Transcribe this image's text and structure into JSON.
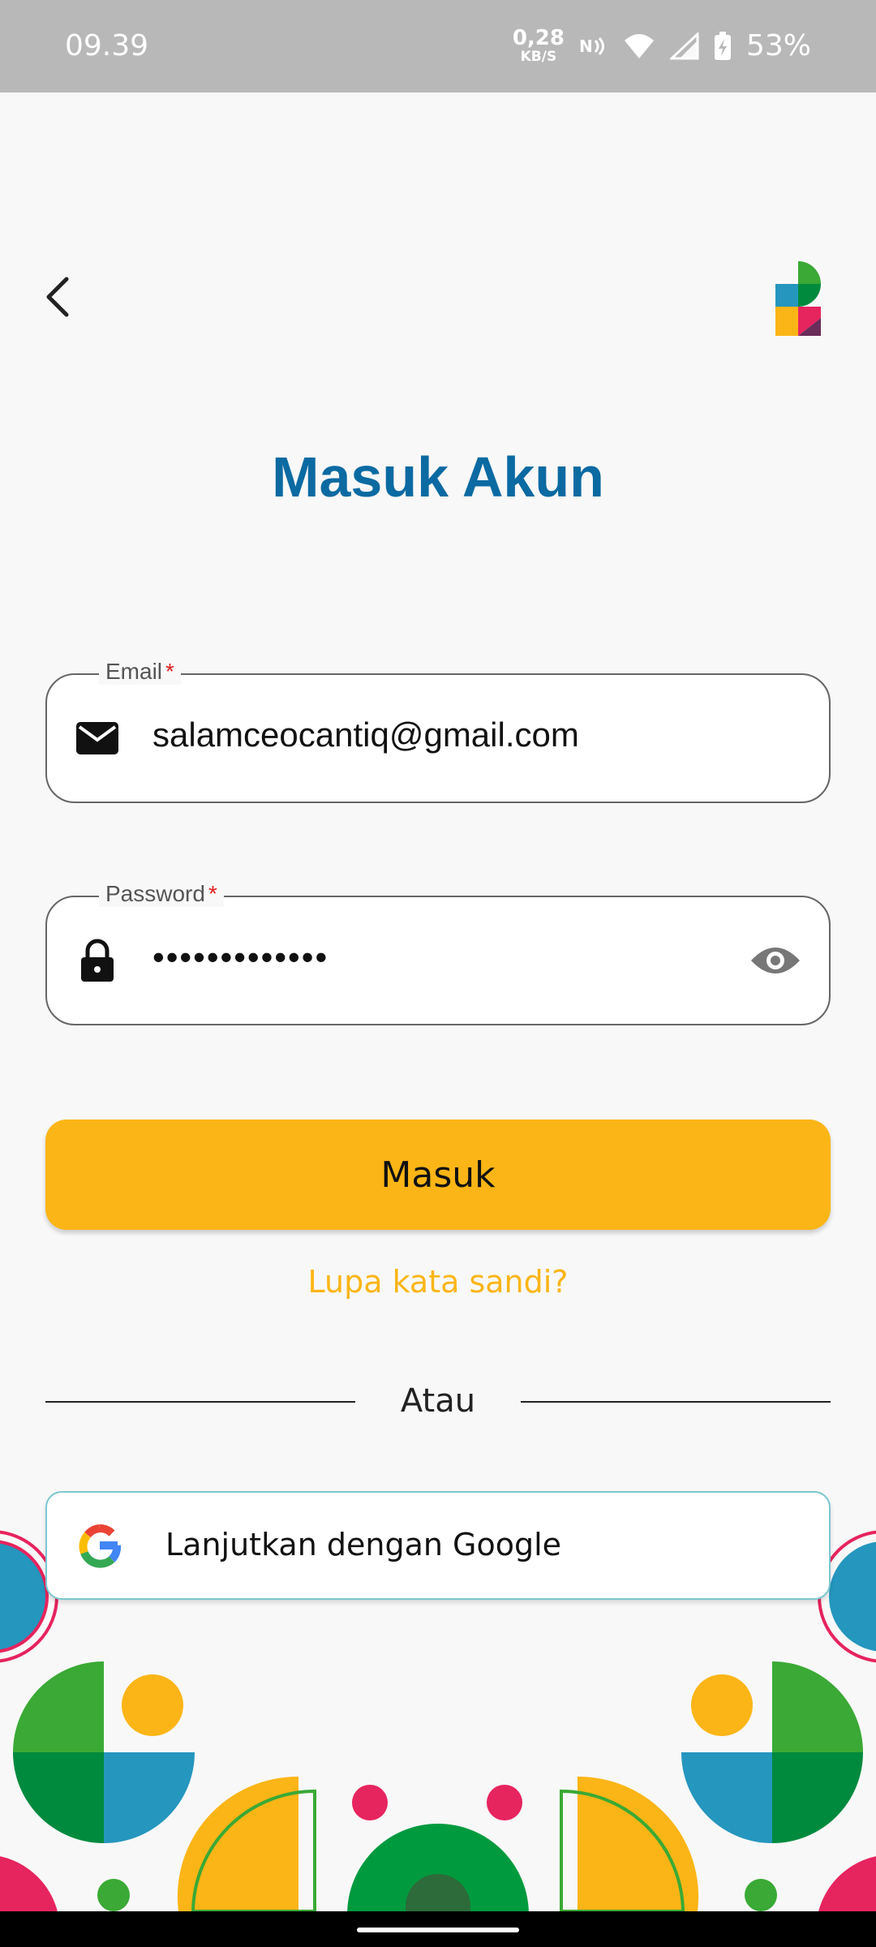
{
  "status_bar": {
    "time": "09.39",
    "net_speed_value": "0,28",
    "net_speed_unit": "KB/S",
    "battery": "53%"
  },
  "header": {
    "title": "Masuk Akun"
  },
  "form": {
    "email": {
      "label": "Email",
      "required_mark": "*",
      "value": "salamceocantiq@gmail.com"
    },
    "password": {
      "label": "Password",
      "required_mark": "*",
      "value": "•••••••••••••"
    }
  },
  "actions": {
    "login_label": "Masuk",
    "forgot_label": "Lupa kata sandi?",
    "divider_label": "Atau",
    "google_label": "Lanjutkan dengan Google"
  },
  "icons": {
    "back": "chevron-left-icon",
    "email": "mail-icon",
    "password": "lock-icon",
    "toggle_visibility": "eye-icon",
    "google": "google-icon"
  },
  "colors": {
    "title": "#0b6aa2",
    "primary_button": "#fbb516",
    "link": "#fbb516",
    "required": "#e01f1f",
    "google_border": "#7cc7cf"
  }
}
